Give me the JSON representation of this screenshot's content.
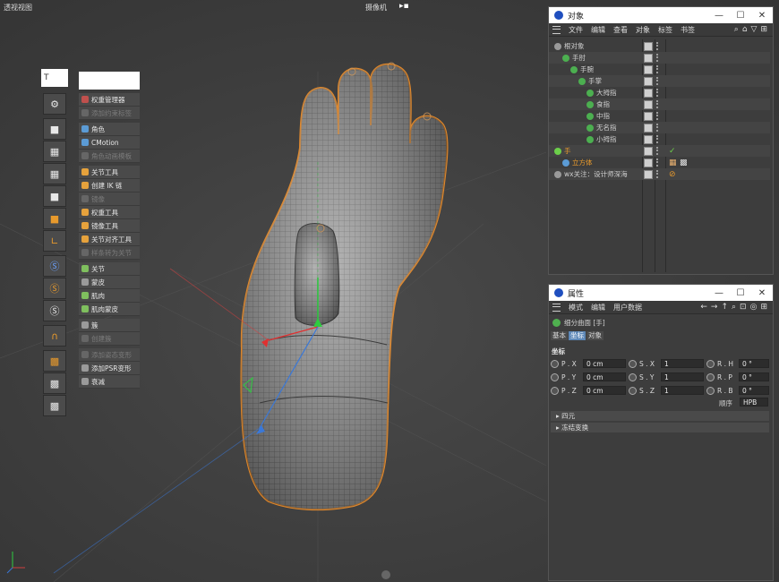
{
  "viewport": {
    "title": "透视视图",
    "camera_label": "摄像机",
    "camera_icon": "camera-icon"
  },
  "toolbar": {
    "top_label": "T",
    "buttons": [
      "joint-icon",
      "cube-icon",
      "checker-cube-icon",
      "checker-cube-icon",
      "cube-icon",
      "cube-orange-icon",
      "axis-l-icon",
      "s-circle-icon",
      "s-circle-orange-icon",
      "s-circle-icon",
      "magnet-icon",
      "grid-orange-icon",
      "grid-lock-icon",
      "grid-dots-icon"
    ]
  },
  "character_menu": {
    "items": [
      {
        "label": "权重管理器",
        "enabled": true,
        "color": "#c0504d"
      },
      {
        "label": "添加约束标签",
        "enabled": false,
        "color": "#666666"
      },
      {
        "label": "角色",
        "enabled": true,
        "color": "#5b9bd5"
      },
      {
        "label": "CMotion",
        "enabled": true,
        "color": "#5b9bd5"
      },
      {
        "label": "角色动画模板",
        "enabled": false,
        "color": "#666666"
      },
      {
        "label": "关节工具",
        "enabled": true,
        "color": "#e6a23c"
      },
      {
        "label": "创建 IK 链",
        "enabled": true,
        "color": "#e6a23c"
      },
      {
        "label": "镜像",
        "enabled": false,
        "color": "#666666"
      },
      {
        "label": "权重工具",
        "enabled": true,
        "color": "#e6a23c"
      },
      {
        "label": "镜像工具",
        "enabled": true,
        "color": "#e6a23c"
      },
      {
        "label": "关节对齐工具",
        "enabled": true,
        "color": "#e6a23c"
      },
      {
        "label": "样条转为关节",
        "enabled": false,
        "color": "#666666"
      },
      {
        "label": "关节",
        "enabled": true,
        "color": "#7fbf5e"
      },
      {
        "label": "蒙皮",
        "enabled": true,
        "color": "#9a9a9a"
      },
      {
        "label": "肌肉",
        "enabled": true,
        "color": "#7fbf5e"
      },
      {
        "label": "肌肉蒙皮",
        "enabled": true,
        "color": "#7fbf5e"
      },
      {
        "label": "簇",
        "enabled": true,
        "color": "#9a9a9a"
      },
      {
        "label": "创建簇",
        "enabled": false,
        "color": "#666666"
      },
      {
        "label": "添加姿态变形",
        "enabled": false,
        "color": "#666666"
      },
      {
        "label": "添加PSR变形",
        "enabled": true,
        "color": "#9a9a9a"
      },
      {
        "label": "衰减",
        "enabled": true,
        "color": "#9a9a9a"
      }
    ]
  },
  "objects_panel": {
    "title": "对象",
    "menu": [
      "文件",
      "编辑",
      "查看",
      "对象",
      "标签",
      "书签"
    ],
    "tree": [
      {
        "label": "根对象",
        "depth": 0,
        "color": "#cfcfcf",
        "icon": "null-icon"
      },
      {
        "label": "手肘",
        "depth": 1,
        "color": "#cfcfcf",
        "icon": "joint-icon"
      },
      {
        "label": "手腕",
        "depth": 2,
        "color": "#cfcfcf",
        "icon": "joint-icon"
      },
      {
        "label": "手掌",
        "depth": 3,
        "color": "#cfcfcf",
        "icon": "joint-icon"
      },
      {
        "label": "大拇指",
        "depth": 4,
        "color": "#cfcfcf",
        "icon": "joint-icon"
      },
      {
        "label": "食指",
        "depth": 4,
        "color": "#cfcfcf",
        "icon": "joint-icon"
      },
      {
        "label": "中指",
        "depth": 4,
        "color": "#cfcfcf",
        "icon": "joint-icon"
      },
      {
        "label": "无名指",
        "depth": 4,
        "color": "#cfcfcf",
        "icon": "joint-icon"
      },
      {
        "label": "小拇指",
        "depth": 4,
        "color": "#cfcfcf",
        "icon": "joint-icon"
      },
      {
        "label": "手",
        "depth": 0,
        "color": "#e89a2c",
        "icon": "subdivision-icon"
      },
      {
        "label": "立方体",
        "depth": 1,
        "color": "#e89a2c",
        "icon": "cube-icon"
      },
      {
        "label": "wx关注：设计师深海",
        "depth": 0,
        "color": "#cfcfcf",
        "icon": "null-icon"
      }
    ]
  },
  "attr_panel": {
    "title": "属性",
    "menu": [
      "模式",
      "编辑",
      "用户数据"
    ],
    "object_label": "细分曲面 [手]",
    "tabs": [
      "基本",
      "坐标",
      "对象"
    ],
    "active_tab": "坐标",
    "section_title": "坐标",
    "coords": [
      {
        "p_label": "P . X",
        "p_val": "0 cm",
        "s_label": "S . X",
        "s_val": "1",
        "r_label": "R . H",
        "r_val": "0 °"
      },
      {
        "p_label": "P . Y",
        "p_val": "0 cm",
        "s_label": "S . Y",
        "s_val": "1",
        "r_label": "R . P",
        "r_val": "0 °"
      },
      {
        "p_label": "P . Z",
        "p_val": "0 cm",
        "s_label": "S . Z",
        "s_val": "1",
        "r_label": "R . B",
        "r_val": "0 °"
      }
    ],
    "order_label": "顺序",
    "order_value": "HPB",
    "sections": [
      "四元",
      "冻结变换"
    ]
  }
}
